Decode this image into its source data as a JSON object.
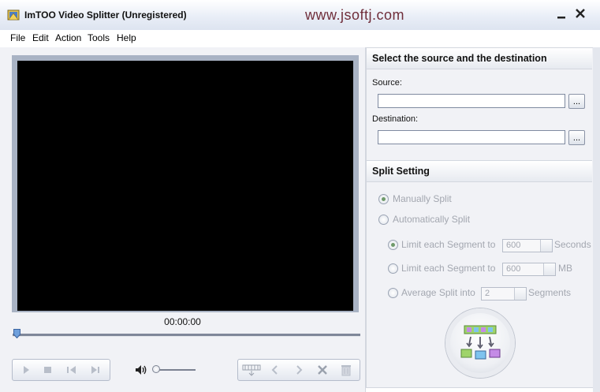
{
  "window": {
    "title": "ImTOO Video Splitter (Unregistered)",
    "watermark": "www.jsoftj.com"
  },
  "menu": [
    "File",
    "Edit",
    "Action",
    "Tools",
    "Help"
  ],
  "player": {
    "time": "00:00:00",
    "position_fraction": 0
  },
  "source_panel": {
    "header": "Select the source and the destination",
    "source_label": "Source:",
    "source_value": "",
    "destination_label": "Destination:",
    "destination_value": "",
    "browse_label": "..."
  },
  "split_panel": {
    "header": "Split Setting",
    "manually_split": "Manually Split",
    "automatically_split": "Automatically Split",
    "limit_seconds_label": "Limit each Segment to",
    "limit_seconds_value": "600",
    "limit_seconds_unit": "Seconds",
    "limit_mb_label": "Limit each Segment to",
    "limit_mb_value": "600",
    "limit_mb_unit": "MB",
    "average_label": "Average Split into",
    "average_value": "2",
    "average_unit": "Segments",
    "selected_mode": "Manually Split",
    "selected_auto_option": "Limit each Segment to Seconds"
  }
}
